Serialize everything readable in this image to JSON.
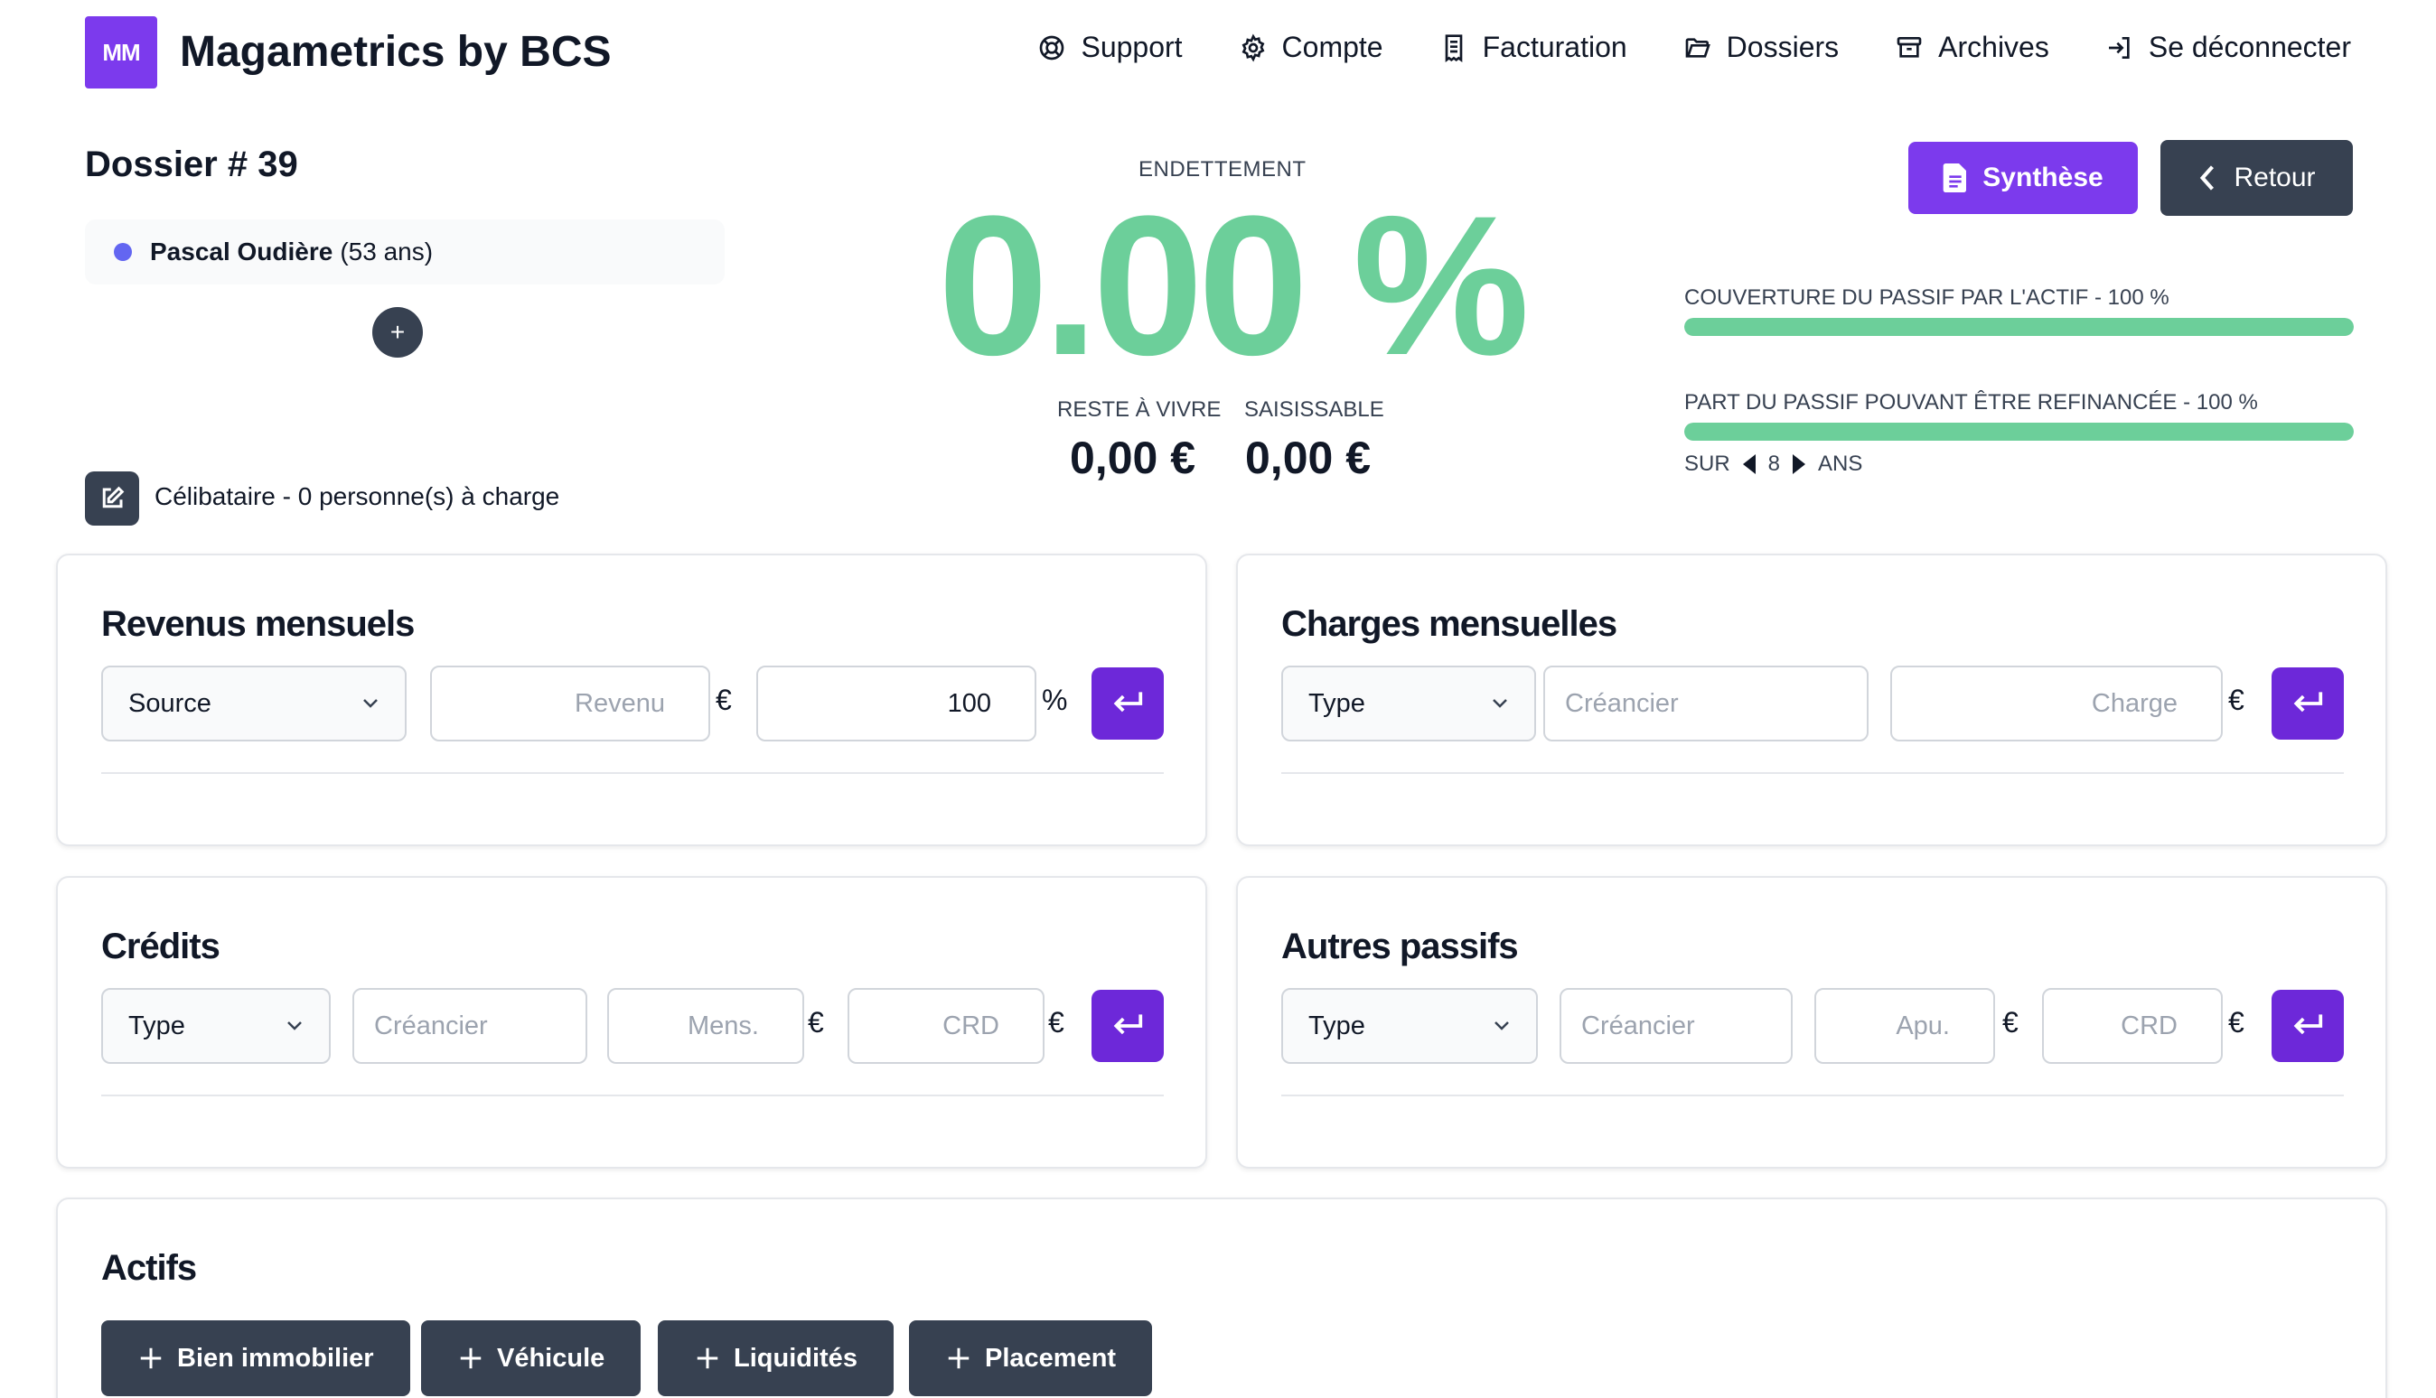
{
  "header": {
    "logo_text": "MM",
    "app_title": "Magametrics by BCS",
    "nav": [
      {
        "label": "Support",
        "icon": "lifebuoy-icon"
      },
      {
        "label": "Compte",
        "icon": "gear-icon"
      },
      {
        "label": "Facturation",
        "icon": "receipt-icon"
      },
      {
        "label": "Dossiers",
        "icon": "folder-open-icon"
      },
      {
        "label": "Archives",
        "icon": "archive-icon"
      },
      {
        "label": "Se déconnecter",
        "icon": "logout-icon"
      }
    ]
  },
  "dossier": {
    "title": "Dossier # 39",
    "person_name": "Pascal Oudière",
    "person_age": "(53 ans)",
    "add_label": "+",
    "situation": "Célibataire - 0 personne(s) à charge"
  },
  "summary": {
    "endettement_label": "ENDETTEMENT",
    "endettement_value": "0.00 %",
    "reste_label": "RESTE À VIVRE",
    "reste_value": "0,00 €",
    "saisissable_label": "SAISISSABLE",
    "saisissable_value": "0,00 €"
  },
  "actions": {
    "synthese": "Synthèse",
    "retour": "Retour"
  },
  "coverage": {
    "couverture_label": "COUVERTURE DU PASSIF PAR L'ACTIF - 100 %",
    "couverture_pct": 100,
    "refinance_label": "PART DU PASSIF POUVANT ÊTRE REFINANCÉE - 100 %",
    "refinance_pct": 100,
    "sur_label": "SUR",
    "years": "8",
    "ans_label": "ANS"
  },
  "revenus": {
    "title": "Revenus mensuels",
    "source": "Source",
    "revenu_placeholder": "Revenu",
    "currency": "€",
    "percent_value": "100",
    "percent_unit": "%"
  },
  "charges": {
    "title": "Charges mensuelles",
    "type": "Type",
    "creancier_placeholder": "Créancier",
    "charge_placeholder": "Charge",
    "currency": "€"
  },
  "credits": {
    "title": "Crédits",
    "type": "Type",
    "creancier_placeholder": "Créancier",
    "mens_placeholder": "Mens.",
    "crd_placeholder": "CRD",
    "currency": "€"
  },
  "autres": {
    "title": "Autres passifs",
    "type": "Type",
    "creancier_placeholder": "Créancier",
    "apu_placeholder": "Apu.",
    "crd_placeholder": "CRD",
    "currency": "€"
  },
  "actifs": {
    "title": "Actifs",
    "buttons": [
      "Bien immobilier",
      "Véhicule",
      "Liquidités",
      "Placement"
    ]
  }
}
